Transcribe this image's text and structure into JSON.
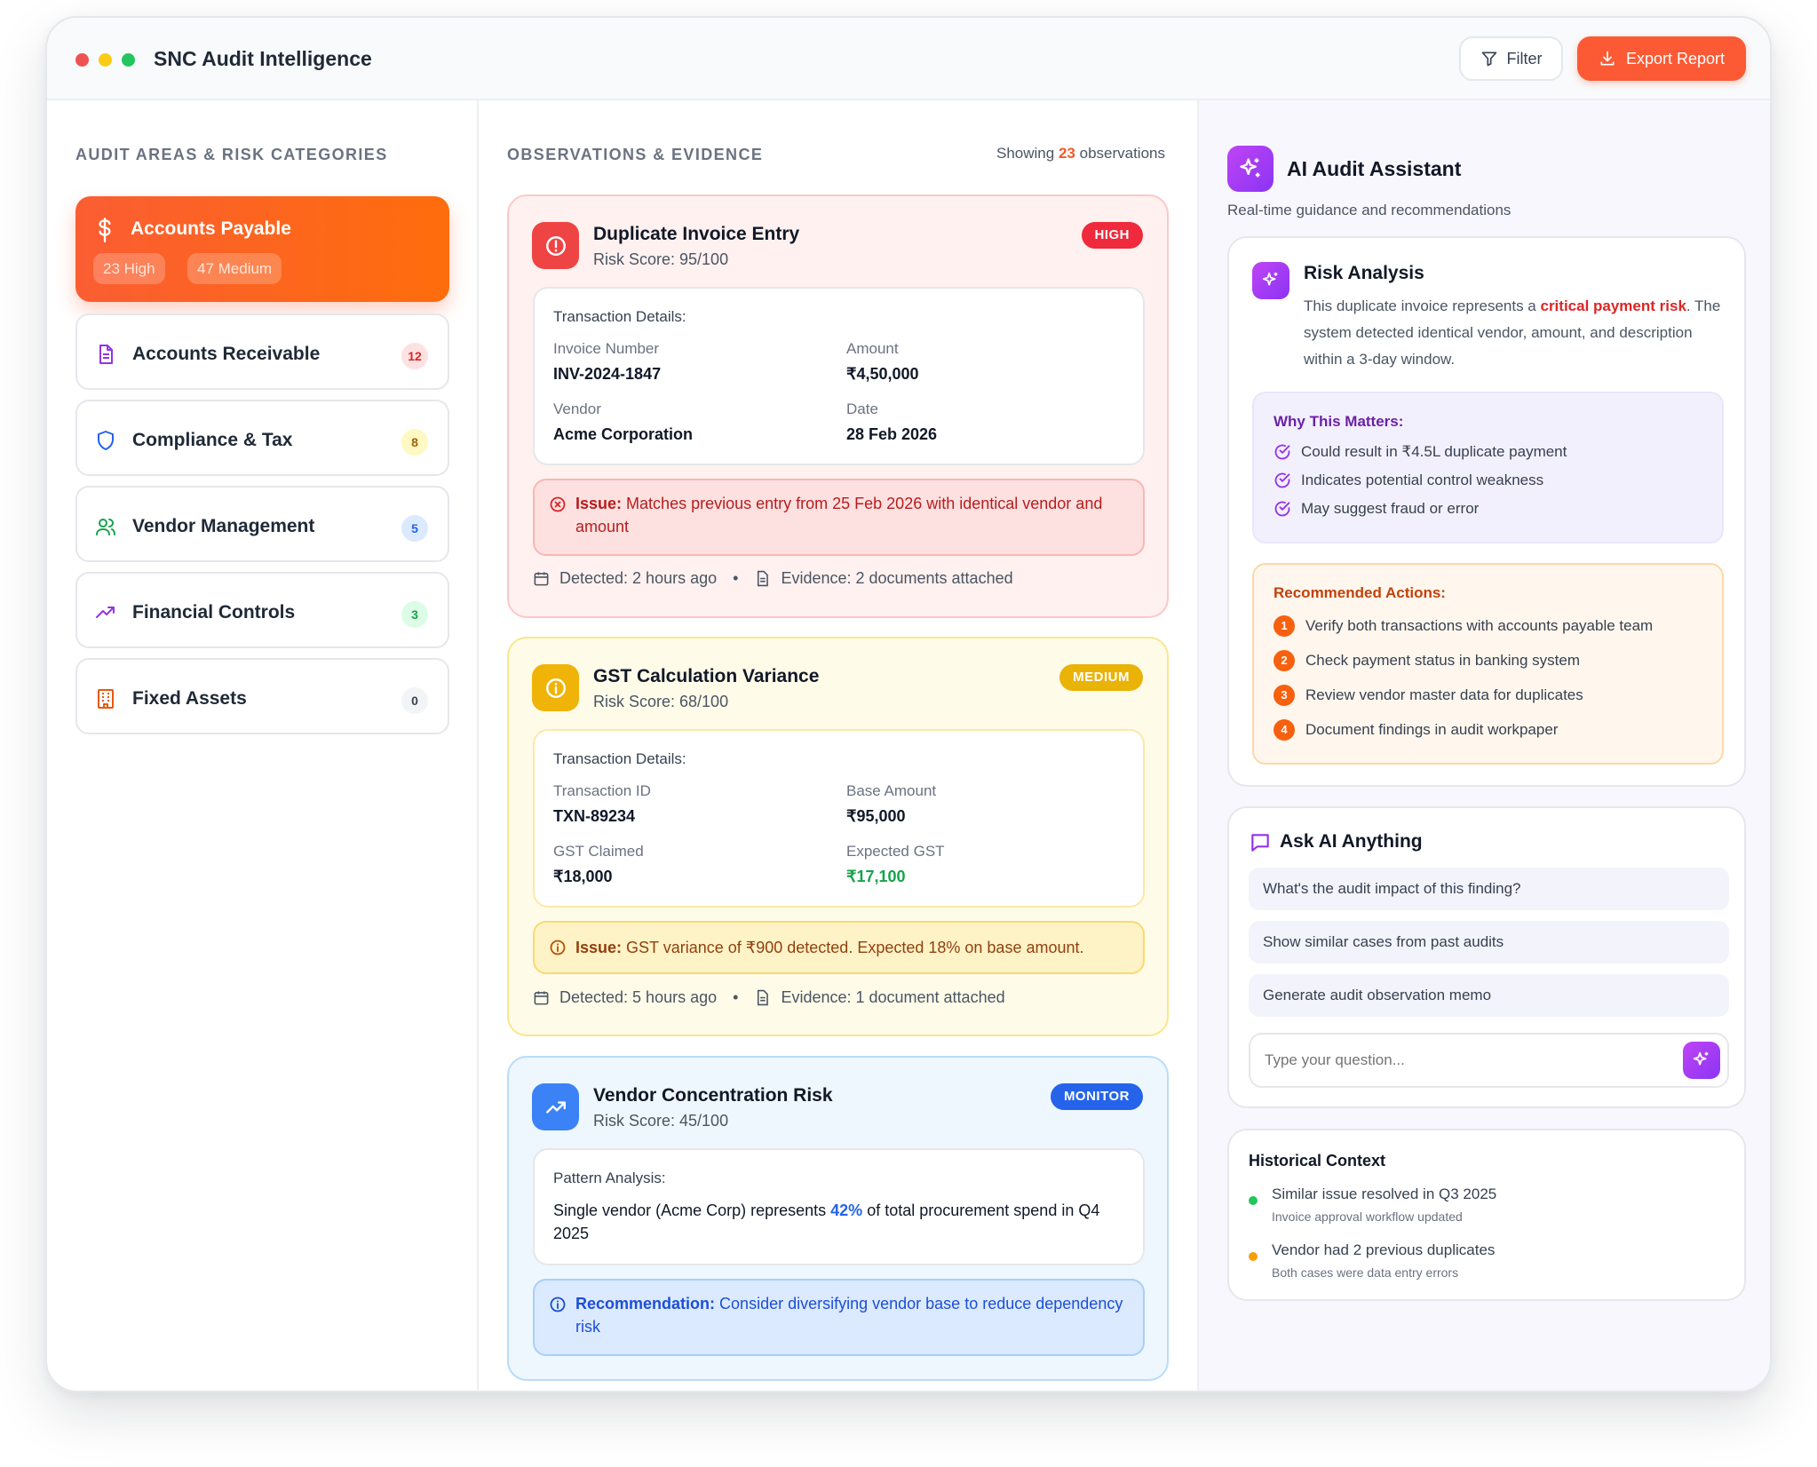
{
  "app": {
    "title": "SNC Audit Intelligence"
  },
  "window_dots": [
    "#f05252",
    "#facc15",
    "#22c55e"
  ],
  "toolbar": {
    "filter_label": "Filter",
    "export_label": "Export Report"
  },
  "left": {
    "section_title": "AUDIT AREAS & RISK CATEGORIES",
    "active": {
      "label": "Accounts Payable",
      "icon": "dollar-icon",
      "pills": [
        "23 High",
        "47 Medium"
      ]
    },
    "items": [
      {
        "label": "Accounts Receivable",
        "icon": "document-icon",
        "count": "12"
      },
      {
        "label": "Compliance & Tax",
        "icon": "shield-icon",
        "count": "8"
      },
      {
        "label": "Vendor Management",
        "icon": "users-icon",
        "count": "5"
      },
      {
        "label": "Financial Controls",
        "icon": "trend-up-icon",
        "count": "3"
      },
      {
        "label": "Fixed Assets",
        "icon": "building-icon",
        "count": "0"
      }
    ]
  },
  "middle": {
    "section_title": "OBSERVATIONS & EVIDENCE",
    "showing_prefix": "Showing",
    "showing_count": "23",
    "showing_suffix": "observations",
    "observations": [
      {
        "title": "Duplicate Invoice Entry",
        "score": "Risk Score: 95/100",
        "badge": "HIGH",
        "details_heading": "Transaction Details:",
        "fields": [
          {
            "label": "Invoice Number",
            "value": "INV-2024-1847"
          },
          {
            "label": "Amount",
            "value": "₹4,50,000"
          },
          {
            "label": "Vendor",
            "value": "Acme Corporation"
          },
          {
            "label": "Date",
            "value": "28 Feb 2026"
          }
        ],
        "issue_label": "Issue:",
        "issue_text": "Matches previous entry from 25 Feb 2026 with identical vendor and amount",
        "detected": "Detected: 2 hours ago",
        "evidence": "Evidence: 2 documents attached"
      },
      {
        "title": "GST Calculation Variance",
        "score": "Risk Score: 68/100",
        "badge": "MEDIUM",
        "details_heading": "Transaction Details:",
        "fields": [
          {
            "label": "Transaction ID",
            "value": "TXN-89234"
          },
          {
            "label": "Base Amount",
            "value": "₹95,000"
          },
          {
            "label": "GST Claimed",
            "value": "₹18,000"
          },
          {
            "label": "Expected GST",
            "value": "₹17,100"
          }
        ],
        "issue_label": "Issue:",
        "issue_text": "GST variance of ₹900 detected. Expected 18% on base amount.",
        "detected": "Detected: 5 hours ago",
        "evidence": "Evidence: 1 document attached"
      },
      {
        "title": "Vendor Concentration Risk",
        "score": "Risk Score: 45/100",
        "badge": "MONITOR",
        "pattern_heading": "Pattern Analysis:",
        "pattern_pre": "Single vendor (Acme Corp) represents",
        "pattern_highlight": "42%",
        "pattern_post": "of total procurement spend in Q4 2025",
        "rec_label": "Recommendation:",
        "rec_text": "Consider diversifying vendor base to reduce dependency risk"
      }
    ]
  },
  "right": {
    "title": "AI Audit Assistant",
    "subtitle": "Real-time guidance and recommendations",
    "risk": {
      "title": "Risk Analysis",
      "text_pre": "This duplicate invoice represents a",
      "text_highlight": "critical payment risk",
      "text_post": ". The system detected identical vendor, amount, and description within a 3-day window.",
      "why_title": "Why This Matters:",
      "why_items": [
        "Could result in ₹4.5L duplicate payment",
        "Indicates potential control weakness",
        "May suggest fraud or error"
      ],
      "actions_title": "Recommended Actions:",
      "actions": [
        "Verify both transactions with accounts payable team",
        "Check payment status in banking system",
        "Review vendor master data for duplicates",
        "Document findings in audit workpaper"
      ]
    },
    "ask": {
      "title": "Ask AI Anything",
      "suggestions": [
        "What's the audit impact of this finding?",
        "Show similar cases from past audits",
        "Generate audit observation memo"
      ],
      "placeholder": "Type your question..."
    },
    "history": {
      "title": "Historical Context",
      "items": [
        {
          "text": "Similar issue resolved in Q3 2025",
          "sub": "Invoice approval workflow updated",
          "color": "#22c55e"
        },
        {
          "text": "Vendor had 2 previous duplicates",
          "sub": "Both cases were data entry errors",
          "color": "#f59e0b"
        }
      ]
    }
  }
}
